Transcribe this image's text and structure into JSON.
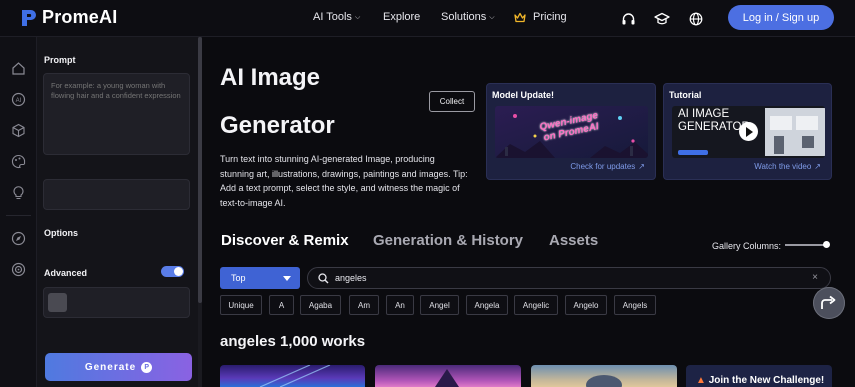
{
  "brand": {
    "name": "PromeAI"
  },
  "nav": {
    "ai_tools": "AI Tools",
    "explore": "Explore",
    "solutions": "Solutions",
    "pricing": "Pricing",
    "login": "Log in / Sign up",
    "icons": [
      "headset-icon",
      "graduation-cap-icon",
      "globe-icon"
    ]
  },
  "rail": {
    "icons": [
      "home-icon",
      "ai-icon",
      "cube-icon",
      "palette-icon",
      "lightbulb-icon",
      "compass-icon",
      "target-icon"
    ]
  },
  "panel": {
    "prompt_label": "Prompt",
    "prompt_placeholder": "For example: a young woman with flowing hair and a confident expression",
    "options_label": "Options",
    "advanced_label": "Advanced",
    "advanced_enabled": true,
    "generate_label": "Generate"
  },
  "hero": {
    "title_line1": "AI Image",
    "title_line2": "Generator",
    "collect": "Collect",
    "description": "Turn text into stunning AI-generated Image, producing stunning art, illustrations, drawings, paintings and images. Tip: Add a text prompt, select the style, and witness the magic of text-to-image AI."
  },
  "cards": {
    "update": {
      "title": "Model Update!",
      "link": "Check for updates",
      "image_text": "Qwen-image on PromeAI"
    },
    "tutorial": {
      "title": "Tutorial",
      "link": "Watch the video",
      "image_text": "AI IMAGE GENERATOR"
    }
  },
  "tabs": [
    "Discover & Remix",
    "Generation & History",
    "Assets"
  ],
  "gallery": {
    "label": "Gallery Columns:"
  },
  "filter": {
    "sort": "Top",
    "search_value": "angeles",
    "chips": [
      "Unique",
      "A",
      "Agaba",
      "Am",
      "An",
      "Angel",
      "Angela",
      "Angelic",
      "Angelo",
      "Angels"
    ]
  },
  "results": {
    "heading": "angeles 1,000 works"
  },
  "challenge": {
    "text": "Join the New Challenge!"
  },
  "colors": {
    "accent": "#4c6fe2",
    "card_bg": "#1d2140",
    "link": "#7f9be8"
  }
}
